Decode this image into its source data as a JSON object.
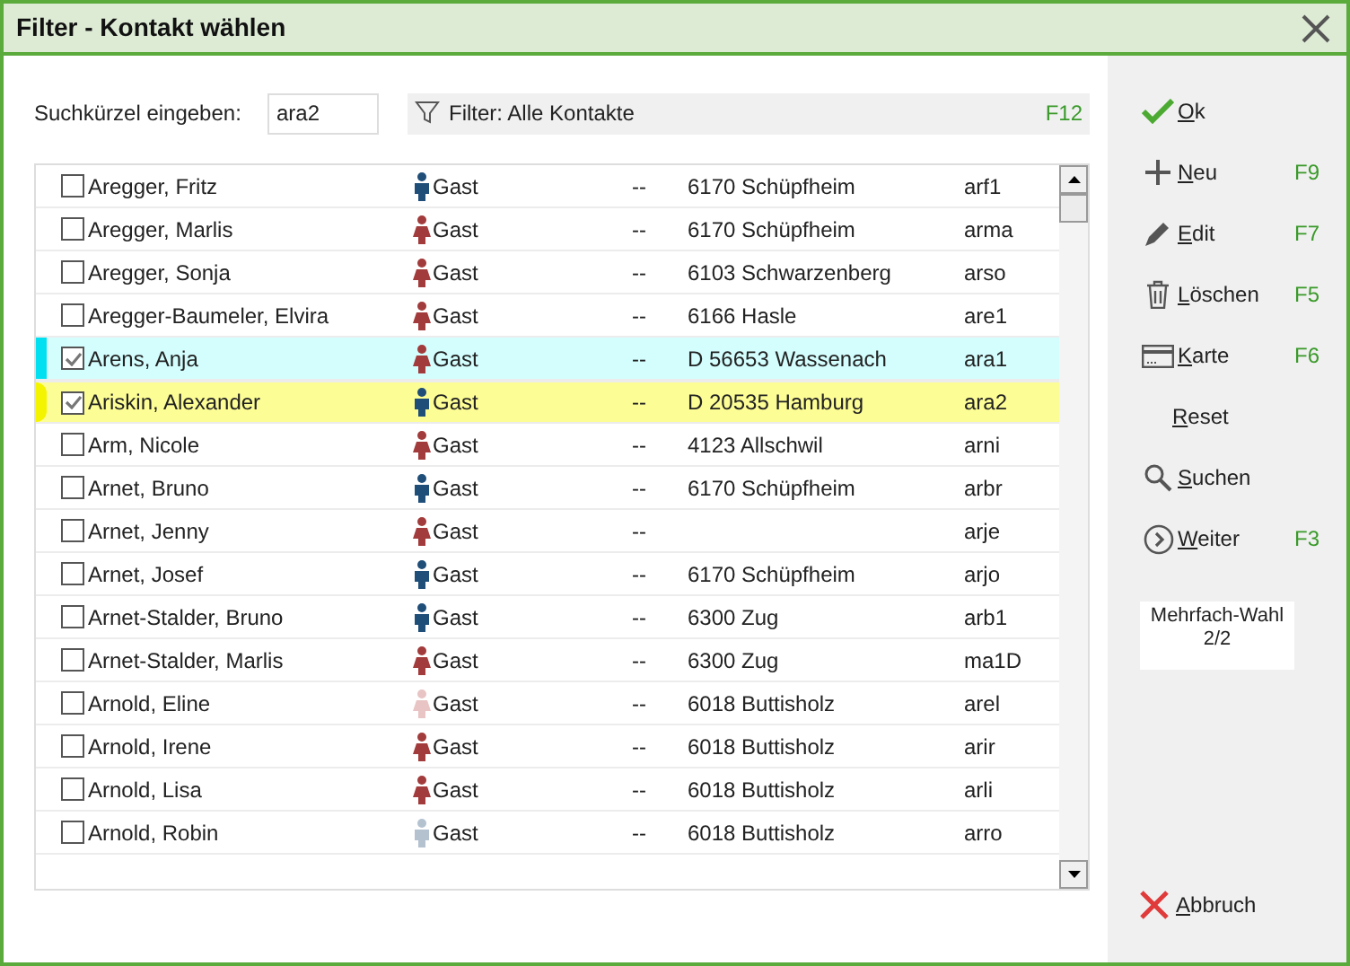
{
  "window": {
    "title": "Filter - Kontakt wählen"
  },
  "search": {
    "label": "Suchkürzel eingeben:",
    "value": "ara2"
  },
  "filter": {
    "label": "Filter: Alle Kontakte",
    "shortcut": "F12"
  },
  "rows": [
    {
      "name": "Aregger, Fritz",
      "checked": false,
      "kind": "normal",
      "color": "#1f4e79",
      "type": "Gast",
      "dash": "--",
      "place": "6170 Schüpfheim",
      "code": "arf1"
    },
    {
      "name": "Aregger, Marlis",
      "checked": false,
      "kind": "normal",
      "color": "#a23b3b",
      "type": "Gast",
      "dash": "--",
      "place": "6170 Schüpfheim",
      "code": "arma"
    },
    {
      "name": "Aregger, Sonja",
      "checked": false,
      "kind": "normal",
      "color": "#a23b3b",
      "type": "Gast",
      "dash": "--",
      "place": "6103 Schwarzenberg",
      "code": "arso"
    },
    {
      "name": "Aregger-Baumeler, Elvira",
      "checked": false,
      "kind": "normal",
      "color": "#a23b3b",
      "type": "Gast",
      "dash": "--",
      "place": "6166 Hasle",
      "code": "are1"
    },
    {
      "name": "Arens, Anja",
      "checked": true,
      "kind": "marked",
      "color": "#a23b3b",
      "type": "Gast",
      "dash": "--",
      "place": "D 56653 Wassenach",
      "code": "ara1"
    },
    {
      "name": "Ariskin, Alexander",
      "checked": true,
      "kind": "current",
      "color": "#1f4e79",
      "type": "Gast",
      "dash": "--",
      "place": "D 20535 Hamburg",
      "code": "ara2"
    },
    {
      "name": "Arm, Nicole",
      "checked": false,
      "kind": "normal",
      "color": "#a23b3b",
      "type": "Gast",
      "dash": "--",
      "place": "4123 Allschwil",
      "code": "arni"
    },
    {
      "name": "Arnet, Bruno",
      "checked": false,
      "kind": "normal",
      "color": "#1f4e79",
      "type": "Gast",
      "dash": "--",
      "place": "6170 Schüpfheim",
      "code": "arbr"
    },
    {
      "name": "Arnet, Jenny",
      "checked": false,
      "kind": "normal",
      "color": "#a23b3b",
      "type": "Gast",
      "dash": "--",
      "code": "arje"
    },
    {
      "name": "Arnet, Josef",
      "checked": false,
      "kind": "normal",
      "color": "#1f4e79",
      "type": "Gast",
      "dash": "--",
      "place": "6170 Schüpfheim",
      "code": "arjo"
    },
    {
      "name": "Arnet-Stalder, Bruno",
      "checked": false,
      "kind": "normal",
      "color": "#1f4e79",
      "type": "Gast",
      "dash": "--",
      "place": "6300 Zug",
      "code": "arb1"
    },
    {
      "name": "Arnet-Stalder, Marlis",
      "checked": false,
      "kind": "normal",
      "color": "#a23b3b",
      "type": "Gast",
      "dash": "--",
      "place": "6300 Zug",
      "code": "ma1D"
    },
    {
      "name": "Arnold, Eline",
      "checked": false,
      "kind": "normal",
      "color": "#e8c4c4",
      "type": "Gast",
      "dash": "--",
      "place": "6018 Buttisholz",
      "code": "arel"
    },
    {
      "name": "Arnold, Irene",
      "checked": false,
      "kind": "normal",
      "color": "#a23b3b",
      "type": "Gast",
      "dash": "--",
      "place": "6018 Buttisholz",
      "code": "arir"
    },
    {
      "name": "Arnold, Lisa",
      "checked": false,
      "kind": "normal",
      "color": "#a23b3b",
      "type": "Gast",
      "dash": "--",
      "place": "6018 Buttisholz",
      "code": "arli"
    },
    {
      "name": "Arnold, Robin",
      "checked": false,
      "kind": "normal",
      "color": "#b4c2d0",
      "type": "Gast",
      "dash": "--",
      "place": "6018 Buttisholz",
      "code": "arro"
    }
  ],
  "actions": [
    {
      "kind": "ok",
      "label": "Ok"
    },
    {
      "kind": "new",
      "label": "Neu",
      "shortcut": "F9"
    },
    {
      "kind": "edit",
      "label": "Edit",
      "shortcut": "F7"
    },
    {
      "kind": "delete",
      "label": "Löschen",
      "shortcut": "F5"
    },
    {
      "kind": "card",
      "label": "Karte",
      "shortcut": "F6"
    },
    {
      "kind": "reset",
      "label": "Reset"
    },
    {
      "kind": "search",
      "label": "Suchen"
    },
    {
      "kind": "next",
      "label": "Weiter",
      "shortcut": "F3"
    }
  ],
  "multi_select": {
    "label": "Mehrfach-Wahl",
    "count": "2/2"
  },
  "cancel": {
    "label": "Abbruch"
  }
}
